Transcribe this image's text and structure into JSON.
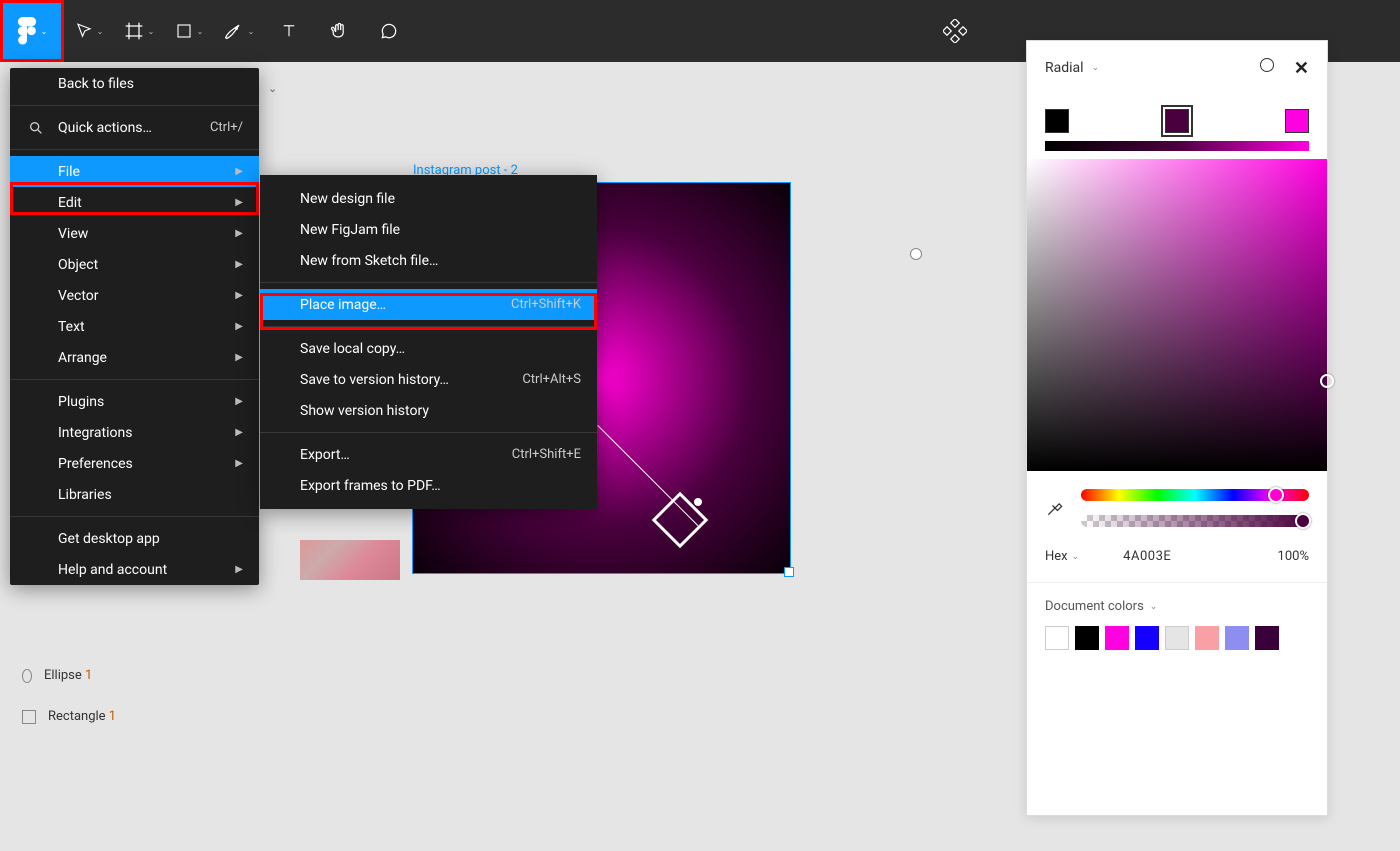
{
  "toolbar": {
    "tools": [
      "move",
      "frame",
      "shape",
      "pen",
      "text",
      "hand",
      "comment"
    ]
  },
  "menu": {
    "back": "Back to files",
    "quick": "Quick actions…",
    "quick_shortcut": "Ctrl+/",
    "items": [
      "File",
      "Edit",
      "View",
      "Object",
      "Vector",
      "Text",
      "Arrange"
    ],
    "group2": [
      "Plugins",
      "Integrations",
      "Preferences",
      "Libraries"
    ],
    "group3": [
      "Get desktop app",
      "Help and account"
    ]
  },
  "submenu": {
    "g1": [
      "New design file",
      "New FigJam file",
      "New from Sketch file…"
    ],
    "place": "Place image…",
    "place_shortcut": "Ctrl+Shift+K",
    "g2": [
      {
        "label": "Save local copy…",
        "sc": ""
      },
      {
        "label": "Save to version history…",
        "sc": "Ctrl+Alt+S"
      },
      {
        "label": "Show version history",
        "sc": ""
      }
    ],
    "g3": [
      {
        "label": "Export…",
        "sc": "Ctrl+Shift+E"
      },
      {
        "label": "Export frames to PDF…",
        "sc": ""
      }
    ]
  },
  "canvas": {
    "frame_label": "Instagram post - 2"
  },
  "layers": {
    "ellipse": {
      "name": "Ellipse ",
      "num": "1"
    },
    "rect": {
      "name": "Rectangle ",
      "num": "1"
    }
  },
  "color_panel": {
    "type": "Radial",
    "stops": [
      {
        "pos": 0,
        "color": "#000000"
      },
      {
        "pos": 50,
        "color": "#4a003e"
      },
      {
        "pos": 100,
        "color": "#ff00e0"
      }
    ],
    "hex_label": "Hex",
    "hex_value": "4A003E",
    "opacity": "100%",
    "doc_label": "Document colors",
    "doc_swatches": [
      "#ffffff",
      "#000000",
      "#ff00e0",
      "#1500ff",
      "#e5e5e5",
      "#f8a0a5",
      "#8e8ef0",
      "#3a003a"
    ]
  }
}
